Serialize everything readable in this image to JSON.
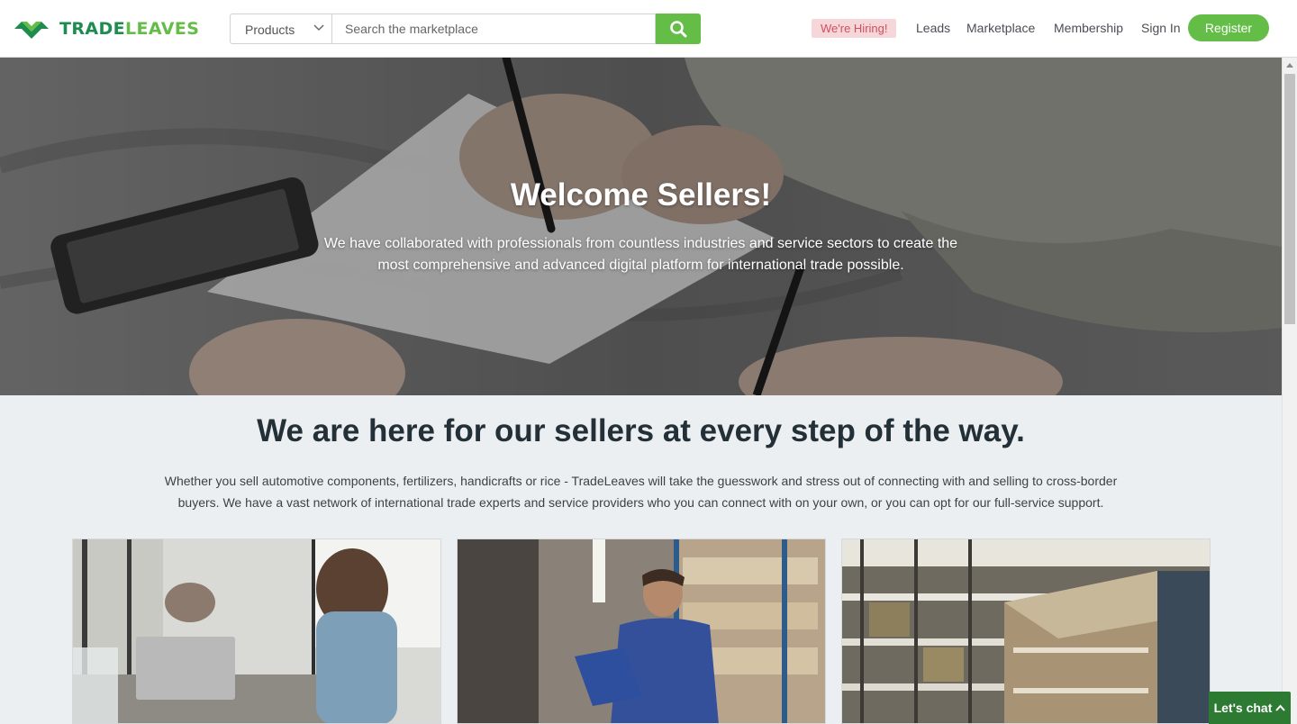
{
  "header": {
    "logo_text_dark": "TRADE",
    "logo_text_light": "LEAVES",
    "search": {
      "category": "Products",
      "placeholder": "Search the marketplace",
      "button_icon": "search-icon"
    },
    "hiring_badge": "We're Hiring!",
    "nav": {
      "leads": "Leads",
      "marketplace": "Marketplace",
      "membership": "Membership",
      "sign_in": "Sign In"
    },
    "register": "Register"
  },
  "hero": {
    "title": "Welcome Sellers!",
    "text": "We have collaborated with professionals from countless industries and service sectors to create the most comprehensive and advanced digital platform for international trade possible."
  },
  "section": {
    "title": "We are here for our sellers at every step of the way.",
    "text": "Whether you sell automotive components, fertilizers, handicrafts or rice - TradeLeaves will take the guesswork and stress out of connecting with and selling to cross-border buyers. We have a vast network of international trade experts and service providers who you can connect with on your own, or you can opt for our full-service support."
  },
  "chat": {
    "label": "Let's chat",
    "icon": "chevron-up-icon"
  },
  "colors": {
    "brand_green": "#64bd47",
    "brand_dark_green": "#1e8b4f",
    "chat_green": "#2d7a33",
    "hiring_bg": "#f5d7da",
    "hiring_text": "#d24f5d",
    "heading": "#243038"
  }
}
